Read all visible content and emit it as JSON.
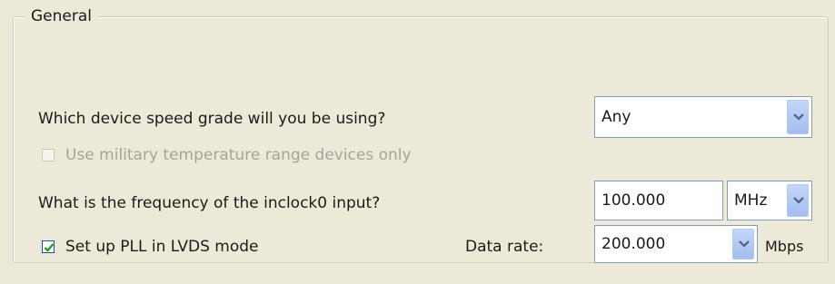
{
  "group": {
    "title": "General"
  },
  "speed_grade": {
    "question": "Which device speed grade will you be using?",
    "value": "Any"
  },
  "military": {
    "label": "Use military temperature range devices only",
    "checked": false,
    "enabled": false
  },
  "inclock": {
    "question": "What is the frequency of the inclock0 input?",
    "value": "100.000",
    "unit": "MHz"
  },
  "pll": {
    "label": "Set up PLL in LVDS mode",
    "checked": true
  },
  "data_rate": {
    "label": "Data rate:",
    "value": "200.000",
    "unit": "Mbps"
  },
  "icons": {
    "dropdown": "chevron-down-icon",
    "check": "checkmark-icon"
  },
  "colors": {
    "background": "#ece9d8",
    "field_border": "#7f9db9",
    "check_green": "#21a121",
    "disabled_text": "#a5a49b"
  }
}
